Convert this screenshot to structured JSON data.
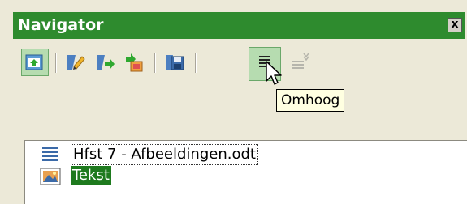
{
  "window": {
    "title": "Navigator",
    "close_symbol": "x"
  },
  "toolbar": {
    "items": [
      {
        "icon": "content-view-icon",
        "state": "pressed"
      },
      {
        "icon": "edit-icon"
      },
      {
        "icon": "promote-level-icon"
      },
      {
        "icon": "demote-level-icon"
      },
      {
        "icon": "save-icon"
      },
      {
        "icon": "move-up-icon",
        "state": "hover"
      },
      {
        "icon": "move-down-icon",
        "state": "disabled"
      }
    ],
    "tooltip": "Omhoog"
  },
  "tree": {
    "document": "Hfst 7 - Afbeeldingen.odt",
    "selected_item": "Tekst"
  },
  "colors": {
    "titlebar": "#2e8b2e",
    "selection": "#1e7a1e",
    "panel_bg": "#ece9d8",
    "tooltip_bg": "#ffffe1"
  }
}
